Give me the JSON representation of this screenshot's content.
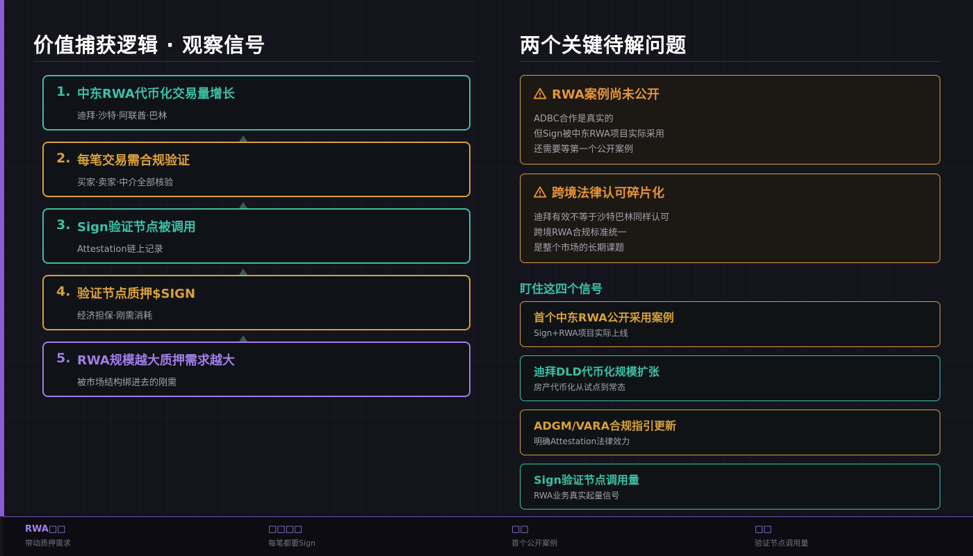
{
  "colors": {
    "teal": "#3dbfa5",
    "gold": "#d9a03a",
    "purple": "#a07ee6",
    "warn": "#e4943a"
  },
  "left": {
    "title": "价值捕获逻辑 · 观察信号",
    "steps": [
      {
        "num": "1.",
        "title": "中东RWA代币化交易量增长",
        "sub": "迪拜·沙特·阿联酋·巴林",
        "color": "#3dbfa5"
      },
      {
        "num": "2.",
        "title": "每笔交易需合规验证",
        "sub": "买家·卖家·中介全部核验",
        "color": "#d9a03a"
      },
      {
        "num": "3.",
        "title": "Sign验证节点被调用",
        "sub": "Attestation链上记录",
        "color": "#3dbfa5"
      },
      {
        "num": "4.",
        "title": "验证节点质押$SIGN",
        "sub": "经济担保·刚需消耗",
        "color": "#d9a03a"
      },
      {
        "num": "5.",
        "title": "RWA规模越大质押需求越大",
        "sub": "被市场结构绑进去的刚需",
        "color": "#a07ee6"
      }
    ]
  },
  "right": {
    "title": "两个关键待解问题",
    "issues": [
      {
        "icon": "warning-icon",
        "title": "RWA案例尚未公开",
        "lines": [
          "ADBC合作是真实的",
          "但Sign被中东RWA项目实际采用",
          "还需要等第一个公开案例"
        ]
      },
      {
        "icon": "warning-icon",
        "title": "跨境法律认可碎片化",
        "lines": [
          "迪拜有效不等于沙特巴林同样认可",
          "跨境RWA合规标准统一",
          "是整个市场的长期课题"
        ]
      }
    ],
    "signals_title": "盯住这四个信号",
    "signals": [
      {
        "title": "首个中东RWA公开采用案例",
        "sub": "Sign+RWA项目实际上线",
        "color": "#d9a03a"
      },
      {
        "title": "迪拜DLD代币化规模扩张",
        "sub": "房产代币化从试点到常态",
        "color": "#3dbfa5"
      },
      {
        "title": "ADGM/VARA合规指引更新",
        "sub": "明确Attestation法律效力",
        "color": "#d9a03a"
      },
      {
        "title": "Sign验证节点调用量",
        "sub": "RWA业务真实起量信号",
        "color": "#3dbfa5"
      }
    ]
  },
  "footer": [
    {
      "label": "RWA□□",
      "sub": "带动质押需求"
    },
    {
      "label": "□□□□",
      "sub": "每笔都要Sign"
    },
    {
      "label": "□□",
      "sub": "首个公开案例"
    },
    {
      "label": "□□",
      "sub": "验证节点调用量"
    }
  ]
}
